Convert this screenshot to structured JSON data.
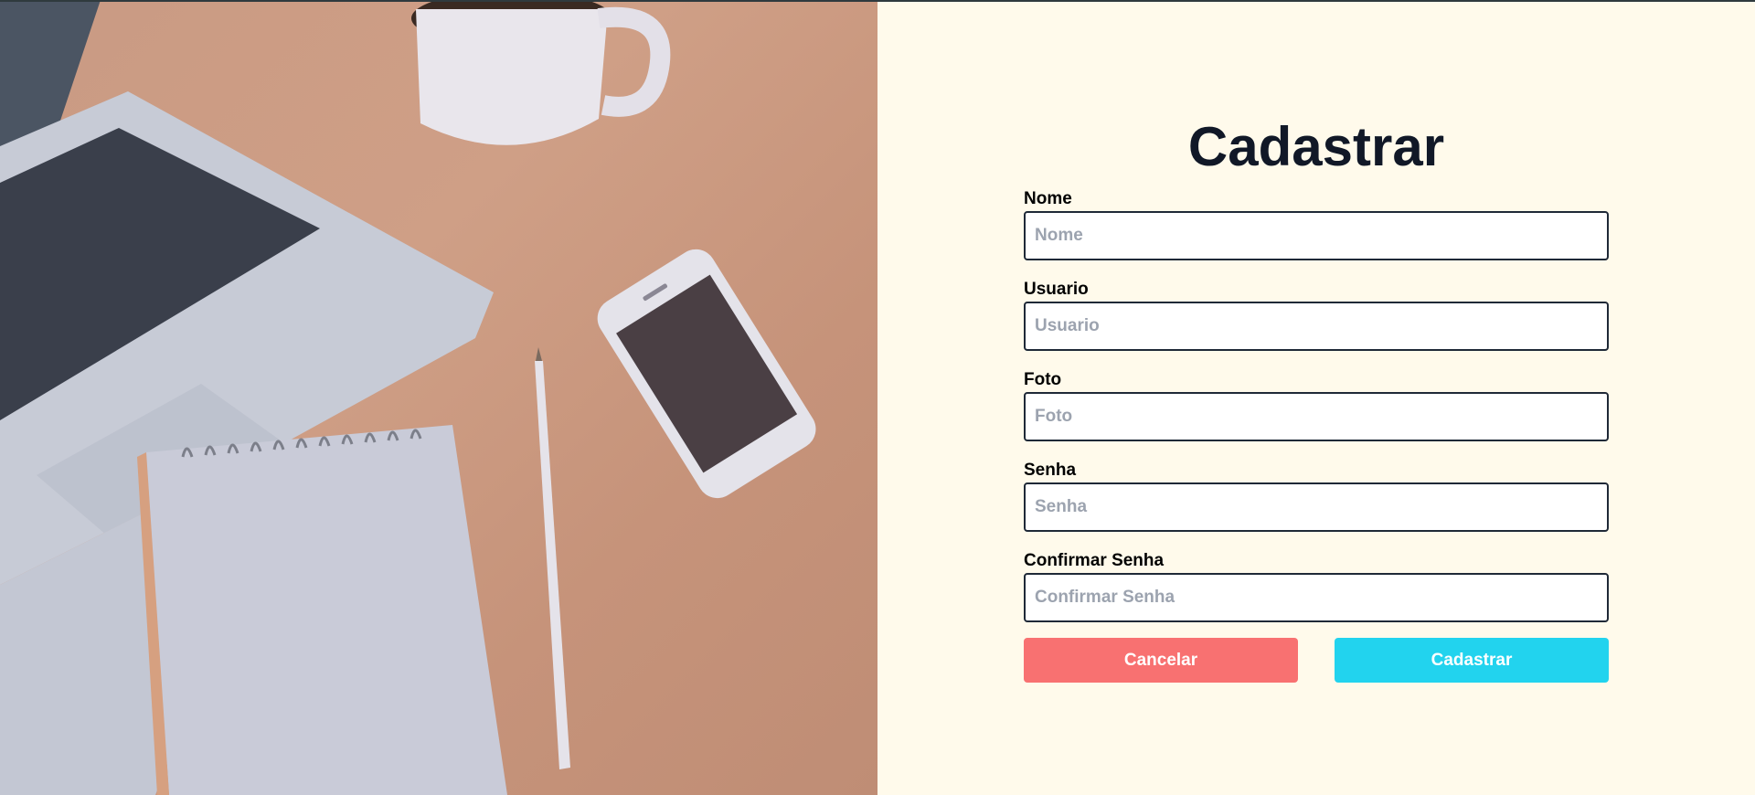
{
  "page": {
    "title": "Cadastrar"
  },
  "form": {
    "fields": [
      {
        "label": "Nome",
        "placeholder": "Nome",
        "value": ""
      },
      {
        "label": "Usuario",
        "placeholder": "Usuario",
        "value": ""
      },
      {
        "label": "Foto",
        "placeholder": "Foto",
        "value": ""
      },
      {
        "label": "Senha",
        "placeholder": "Senha",
        "value": ""
      },
      {
        "label": "Confirmar Senha",
        "placeholder": "Confirmar Senha",
        "value": ""
      }
    ],
    "cancel_label": "Cancelar",
    "submit_label": "Cadastrar"
  },
  "colors": {
    "background": "#fffaeb",
    "title": "#111827",
    "cancel": "#f87171",
    "submit": "#22d3ee",
    "input_border": "#1f2937",
    "placeholder": "#9ca3af"
  }
}
